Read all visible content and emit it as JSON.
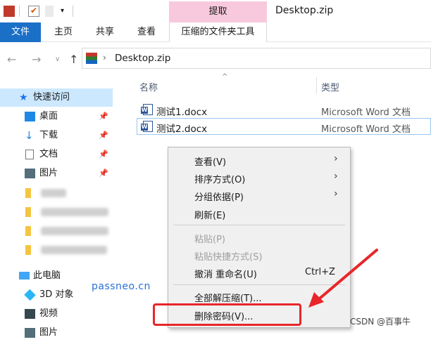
{
  "window": {
    "title": "Desktop.zip"
  },
  "ribbon": {
    "context_group": "提取",
    "tabs": [
      "文件",
      "主页",
      "共享",
      "查看"
    ],
    "context_tab": "压缩的文件夹工具"
  },
  "address": {
    "path": "Desktop.zip"
  },
  "columns": {
    "name": "名称",
    "type": "类型"
  },
  "files": [
    {
      "name": "测试1.docx",
      "type": "Microsoft Word 文档"
    },
    {
      "name": "测试2.docx",
      "type": "Microsoft Word 文档"
    }
  ],
  "nav": {
    "quick_access": "快速访问",
    "items": [
      {
        "label": "桌面",
        "icon": "desktop-icon"
      },
      {
        "label": "下载",
        "icon": "download-icon"
      },
      {
        "label": "文档",
        "icon": "document-icon"
      },
      {
        "label": "图片",
        "icon": "picture-icon"
      }
    ],
    "this_pc": "此电脑",
    "pc_items": [
      {
        "label": "3D 对象",
        "icon": "3d-objects-icon"
      },
      {
        "label": "视频",
        "icon": "video-icon"
      },
      {
        "label": "图片",
        "icon": "picture-icon"
      }
    ]
  },
  "context_menu": {
    "view": "查看(V)",
    "sort": "排序方式(O)",
    "group": "分组依据(P)",
    "refresh": "刷新(E)",
    "paste": "粘贴(P)",
    "paste_shortcut": "粘贴快捷方式(S)",
    "undo": "撤消 重命名(U)",
    "undo_shortcut": "Ctrl+Z",
    "extract_all": "全部解压缩(T)...",
    "remove_password": "删除密码(V)..."
  },
  "overlay": {
    "watermark": "passneo.cn",
    "credit": "CSDN @百事牛"
  },
  "colors": {
    "file_tab": "#1a6fc7",
    "context_tab": "#f8c9dc",
    "annotation": "#e8262a",
    "watermark": "#2b6fd6"
  }
}
